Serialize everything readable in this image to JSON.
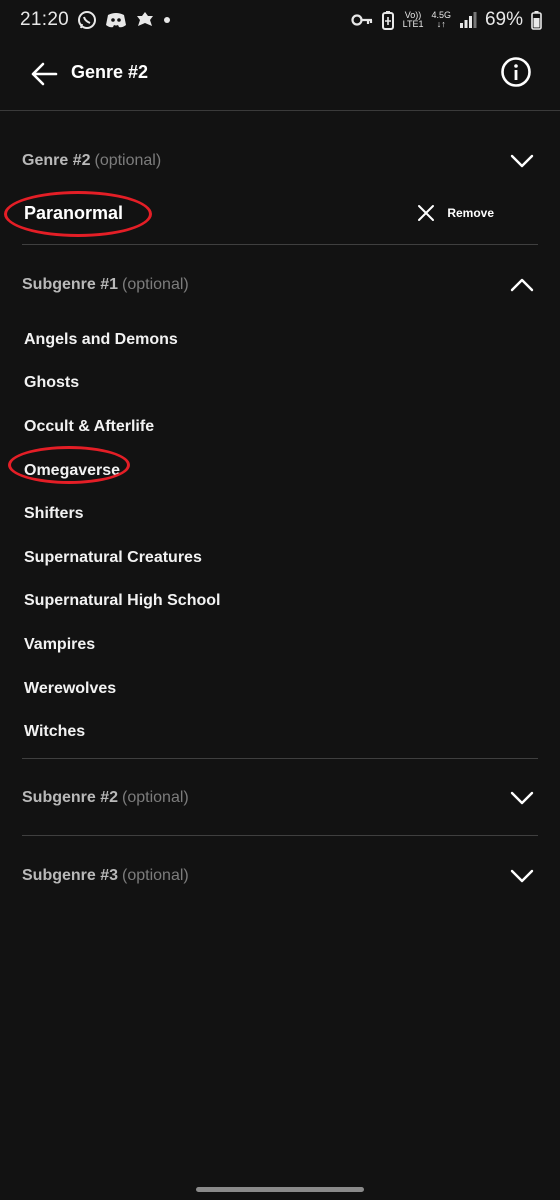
{
  "status_bar": {
    "time": "21:20",
    "network_top": "Vo))",
    "network_bottom": "LTE1",
    "data_type": "4.5G",
    "battery": "69%"
  },
  "app_bar": {
    "title": "Genre #2",
    "back_icon": "arrow-left-icon",
    "info_icon": "info-circle-icon"
  },
  "genre": {
    "label": "Genre #2",
    "optional": "(optional)",
    "selected": "Paranormal",
    "remove_label": "Remove",
    "expanded": false
  },
  "subgenre1": {
    "label": "Subgenre #1",
    "optional": "(optional)",
    "expanded": true,
    "options": [
      "Angels and Demons",
      "Ghosts",
      "Occult & Afterlife",
      "Omegaverse",
      "Shifters",
      "Supernatural Creatures",
      "Supernatural High School",
      "Vampires",
      "Werewolves",
      "Witches"
    ]
  },
  "subgenre2": {
    "label": "Subgenre #2",
    "optional": "(optional)",
    "expanded": false
  },
  "subgenre3": {
    "label": "Subgenre #3",
    "optional": "(optional)",
    "expanded": false
  },
  "colors": {
    "background": "#121212",
    "annotation": "#e41e26",
    "divider": "#3f3f3f"
  }
}
